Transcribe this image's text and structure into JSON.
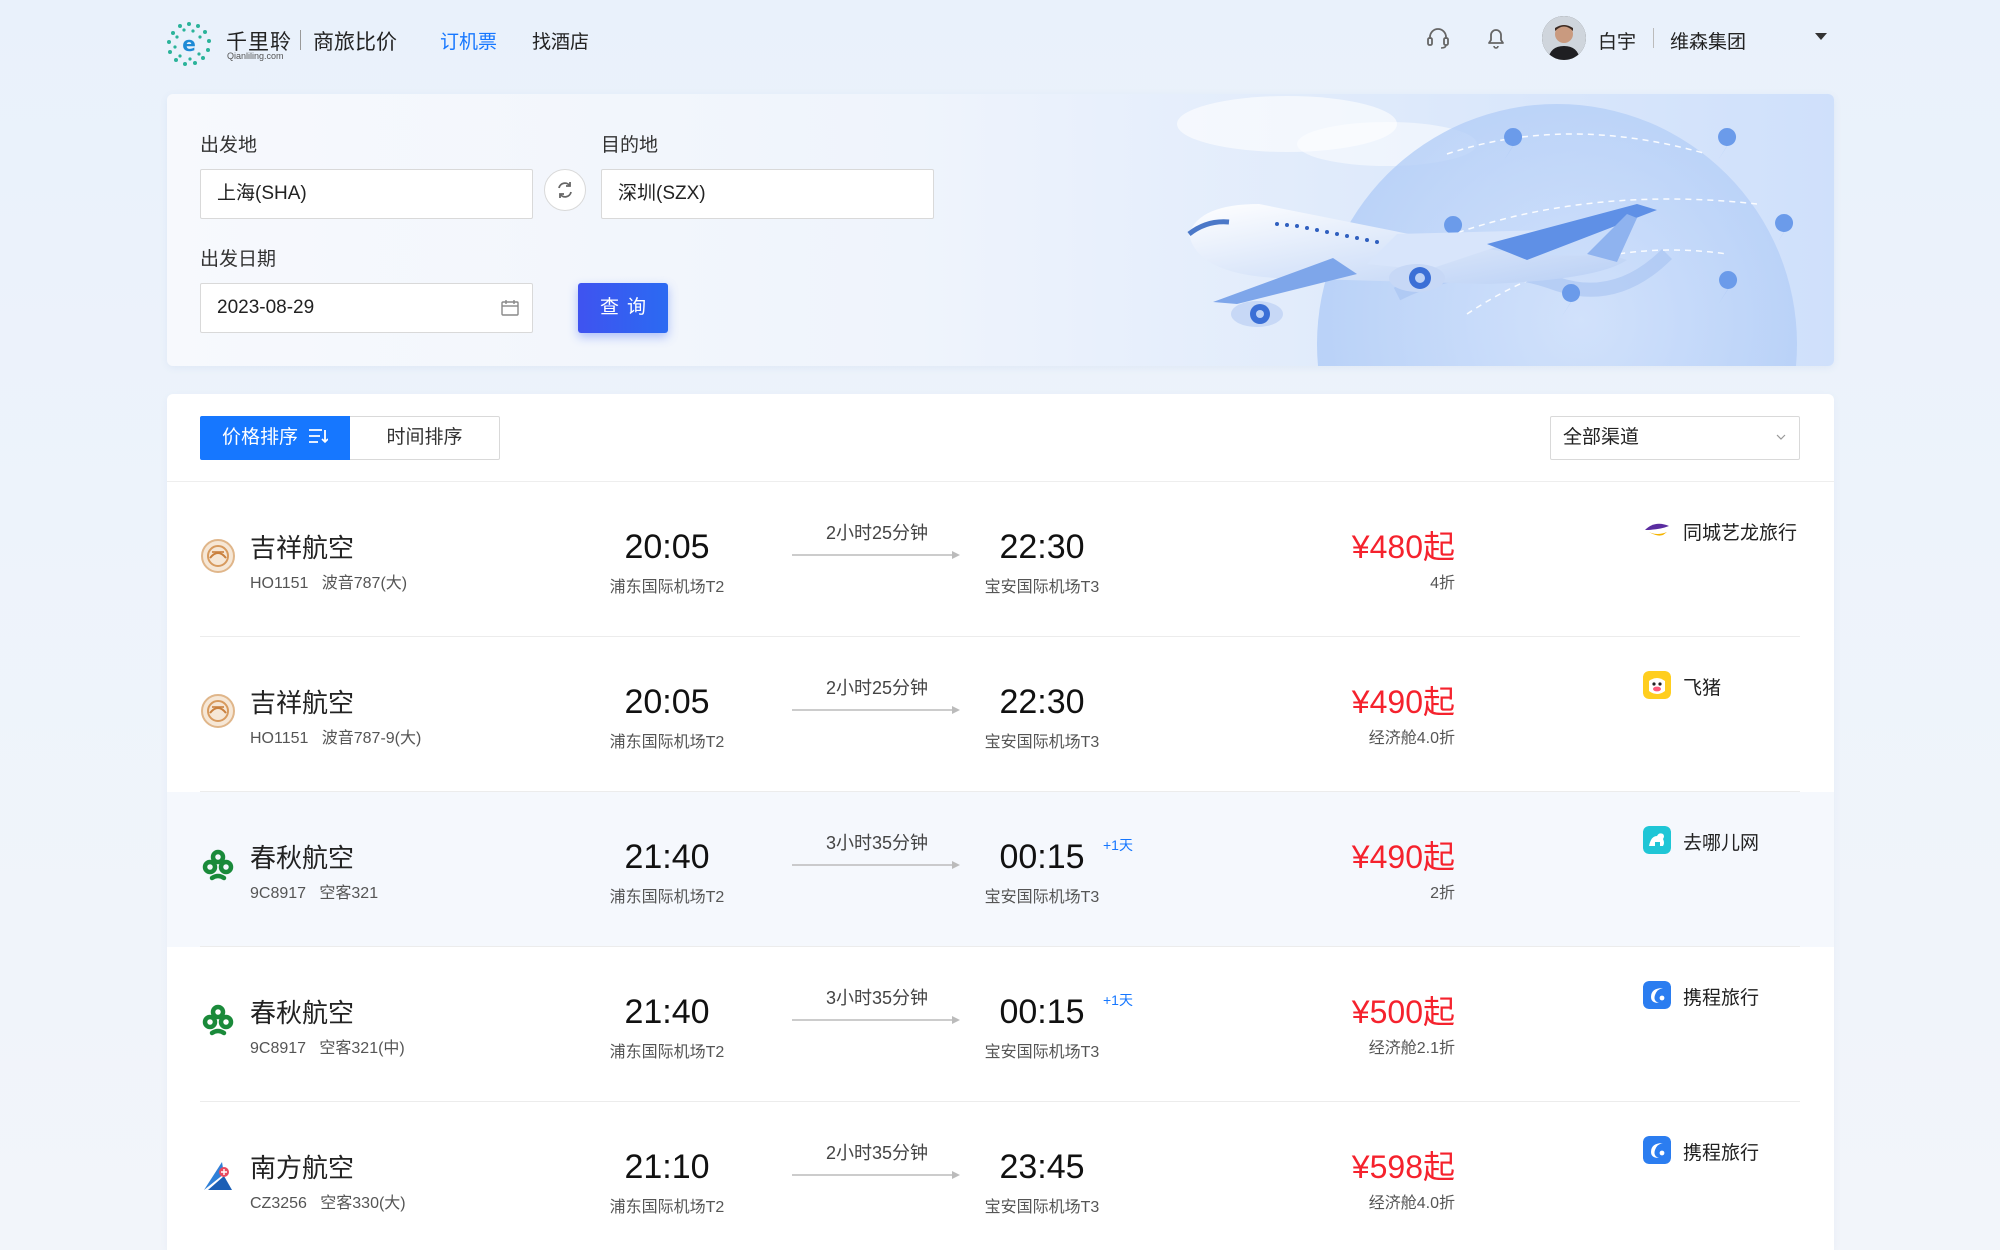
{
  "header": {
    "logo_title": "千里聆",
    "logo_sub": "Qianliling.com",
    "slogan": "商旅比价",
    "nav": [
      {
        "label": "订机票",
        "active": true
      },
      {
        "label": "找酒店",
        "active": false
      }
    ],
    "icons": [
      "headset-icon",
      "bell-icon"
    ],
    "user_name": "白宇",
    "company": "维森集团"
  },
  "search": {
    "origin_label": "出发地",
    "origin_value": "上海(SHA)",
    "dest_label": "目的地",
    "dest_value": "深圳(SZX)",
    "date_label": "出发日期",
    "date_value": "2023-08-29",
    "query_label": "查询"
  },
  "sort": {
    "price_label": "价格排序",
    "time_label": "时间排序",
    "channel_value": "全部渠道"
  },
  "colors": {
    "accent": "#1677ff",
    "price": "#f5222d"
  },
  "flights": [
    {
      "airline": "吉祥航空",
      "code": "HO1151",
      "plane": "波音787(大)",
      "dep_time": "20:05",
      "dep_airport": "浦东国际机场T2",
      "duration": "2小时25分钟",
      "arr_time": "22:30",
      "plus_day": "",
      "arr_airport": "宝安国际机场T3",
      "price": "¥480起",
      "discount": "4折",
      "channel": "同城艺龙旅行",
      "airline_icon": "juneyao-icon",
      "channel_icon": "tongcheng-icon"
    },
    {
      "airline": "吉祥航空",
      "code": "HO1151",
      "plane": "波音787-9(大)",
      "dep_time": "20:05",
      "dep_airport": "浦东国际机场T2",
      "duration": "2小时25分钟",
      "arr_time": "22:30",
      "plus_day": "",
      "arr_airport": "宝安国际机场T3",
      "price": "¥490起",
      "discount": "经济舱4.0折",
      "channel": "飞猪",
      "airline_icon": "juneyao-icon",
      "channel_icon": "fliggy-icon"
    },
    {
      "airline": "春秋航空",
      "code": "9C8917",
      "plane": "空客321",
      "dep_time": "21:40",
      "dep_airport": "浦东国际机场T2",
      "duration": "3小时35分钟",
      "arr_time": "00:15",
      "plus_day": "+1天",
      "arr_airport": "宝安国际机场T3",
      "price": "¥490起",
      "discount": "2折",
      "channel": "去哪儿网",
      "airline_icon": "spring-icon",
      "channel_icon": "qunar-icon"
    },
    {
      "airline": "春秋航空",
      "code": "9C8917",
      "plane": "空客321(中)",
      "dep_time": "21:40",
      "dep_airport": "浦东国际机场T2",
      "duration": "3小时35分钟",
      "arr_time": "00:15",
      "plus_day": "+1天",
      "arr_airport": "宝安国际机场T3",
      "price": "¥500起",
      "discount": "经济舱2.1折",
      "channel": "携程旅行",
      "airline_icon": "spring-icon",
      "channel_icon": "ctrip-icon"
    },
    {
      "airline": "南方航空",
      "code": "CZ3256",
      "plane": "空客330(大)",
      "dep_time": "21:10",
      "dep_airport": "浦东国际机场T2",
      "duration": "2小时35分钟",
      "arr_time": "23:45",
      "plus_day": "",
      "arr_airport": "宝安国际机场T3",
      "price": "¥598起",
      "discount": "经济舱4.0折",
      "channel": "携程旅行",
      "airline_icon": "csair-icon",
      "channel_icon": "ctrip-icon"
    }
  ]
}
